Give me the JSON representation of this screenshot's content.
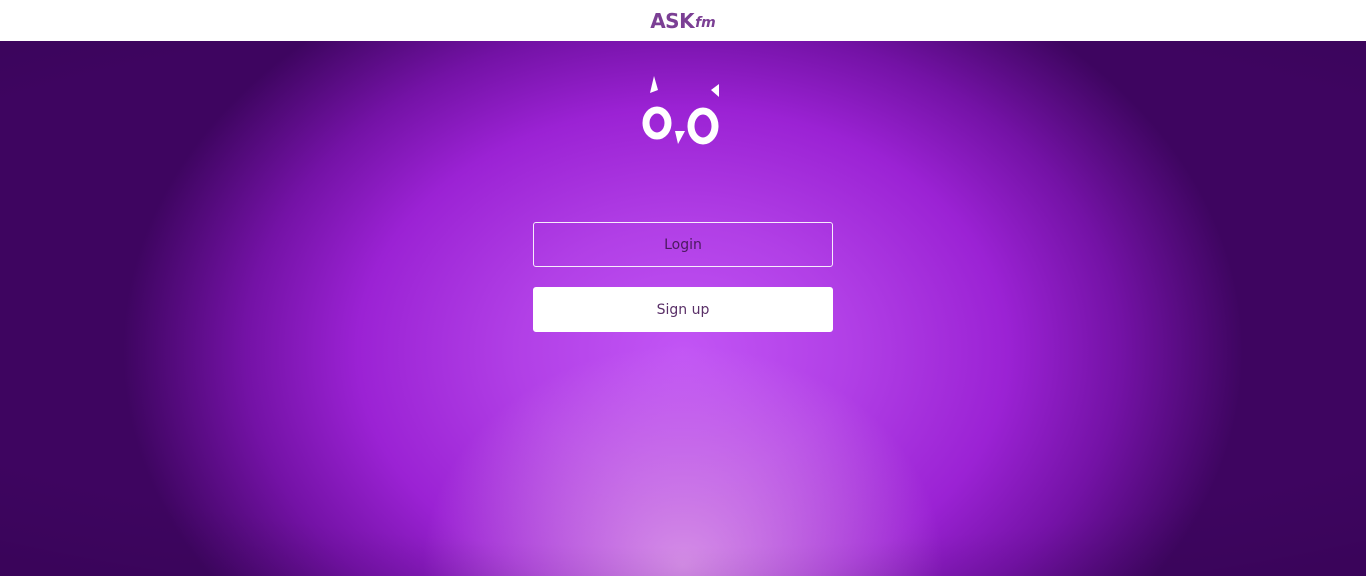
{
  "header": {
    "brand": {
      "primary": "ASK",
      "secondary": "fm"
    },
    "brand_color": "#7b3f94"
  },
  "hero": {
    "mascot_icon": "owl-eyes-icon",
    "background_center": "#c255f5",
    "background_edge": "#3e0560",
    "buttons": {
      "login_label": "Login",
      "signup_label": "Sign up"
    }
  }
}
